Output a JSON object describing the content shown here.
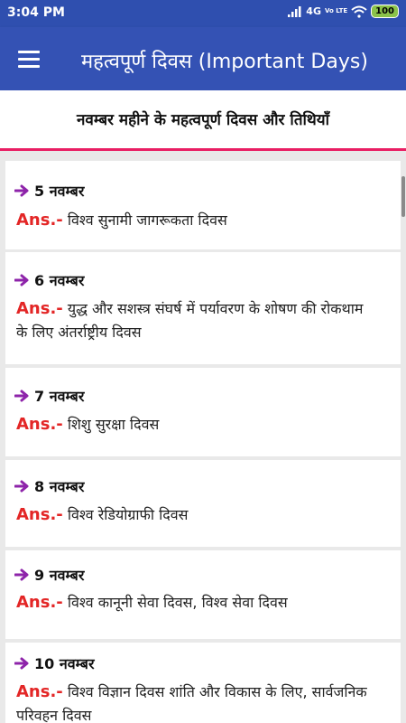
{
  "status_bar": {
    "time": "3:04 PM",
    "network": "4G",
    "volte": "Vo LTE",
    "battery": "100"
  },
  "app_bar": {
    "title": "महत्वपूर्ण दिवस (Important Days)"
  },
  "subheader": {
    "title": "नवम्बर महीने के महत्वपूर्ण दिवस और तिथियाँ"
  },
  "ans_label": "Ans.-",
  "items": [
    {
      "date": "5 नवम्बर",
      "answer": "विश्व सुनामी जागरूकता दिवस"
    },
    {
      "date": "6 नवम्बर",
      "answer": "युद्ध और सशस्त्र संघर्ष में पर्यावरण के शोषण की रोकथाम के लिए अंतर्राष्ट्रीय दिवस"
    },
    {
      "date": "7 नवम्बर",
      "answer": "शिशु सुरक्षा दिवस"
    },
    {
      "date": "8 नवम्बर",
      "answer": "विश्व रेडियोग्राफी दिवस"
    },
    {
      "date": "9 नवम्बर",
      "answer": "विश्व कानूनी सेवा दिवस, विश्व सेवा दिवस"
    },
    {
      "date": "10 नवम्बर",
      "answer": "विश्व विज्ञान दिवस शांति और विकास के लिए, सार्वजनिक परिवहन दिवस"
    }
  ],
  "colors": {
    "status_bar": "#2f4faf",
    "app_bar": "#3452b4",
    "accent": "#e91e63",
    "arrow": "#8e24aa",
    "ans_label": "#e32626"
  },
  "icons": {
    "menu": "hamburger-menu-icon",
    "arrow": "right-arrow-icon",
    "wifi": "wifi-icon",
    "signal": "signal-icon",
    "battery": "battery-icon"
  }
}
